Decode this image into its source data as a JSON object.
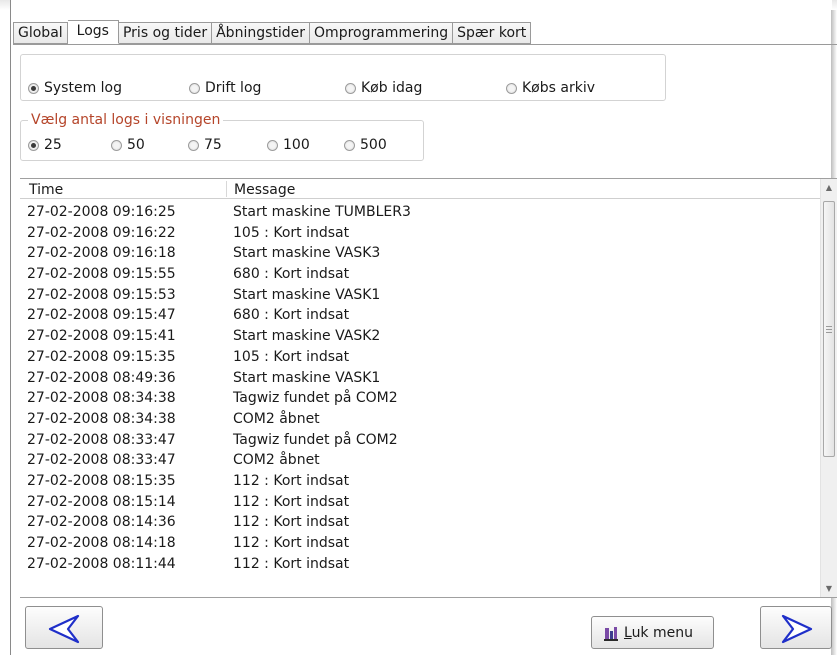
{
  "tabs": [
    {
      "label": "Global",
      "active": false
    },
    {
      "label": "Logs",
      "active": true
    },
    {
      "label": "Pris og tider",
      "active": false
    },
    {
      "label": "Åbningstider",
      "active": false
    },
    {
      "label": "Omprogrammering",
      "active": false
    },
    {
      "label": "Spær kort",
      "active": false
    }
  ],
  "log_type": {
    "options": [
      {
        "label": "System log",
        "checked": true
      },
      {
        "label": "Drift log",
        "checked": false
      },
      {
        "label": "Køb idag",
        "checked": false
      },
      {
        "label": "Købs arkiv",
        "checked": false
      }
    ]
  },
  "log_count": {
    "legend": "Vælg antal logs i visningen",
    "options": [
      {
        "label": "25",
        "checked": true
      },
      {
        "label": "50",
        "checked": false
      },
      {
        "label": "75",
        "checked": false
      },
      {
        "label": "100",
        "checked": false
      },
      {
        "label": "500",
        "checked": false
      }
    ]
  },
  "log_list": {
    "columns": {
      "time": "Time",
      "message": "Message"
    },
    "rows": [
      {
        "time": "27-02-2008 09:16:25",
        "message": "Start maskine TUMBLER3"
      },
      {
        "time": "27-02-2008 09:16:22",
        "message": "105 : Kort indsat"
      },
      {
        "time": "27-02-2008 09:16:18",
        "message": "Start maskine VASK3"
      },
      {
        "time": "27-02-2008 09:15:55",
        "message": "680 : Kort indsat"
      },
      {
        "time": "27-02-2008 09:15:53",
        "message": "Start maskine VASK1"
      },
      {
        "time": "27-02-2008 09:15:47",
        "message": "680 : Kort indsat"
      },
      {
        "time": "27-02-2008 09:15:41",
        "message": "Start maskine VASK2"
      },
      {
        "time": "27-02-2008 09:15:35",
        "message": "105 : Kort indsat"
      },
      {
        "time": "27-02-2008 08:49:36",
        "message": "Start maskine VASK1"
      },
      {
        "time": "27-02-2008 08:34:38",
        "message": "Tagwiz fundet på COM2"
      },
      {
        "time": "27-02-2008 08:34:38",
        "message": "COM2 åbnet"
      },
      {
        "time": "27-02-2008 08:33:47",
        "message": "Tagwiz fundet på COM2"
      },
      {
        "time": "27-02-2008 08:33:47",
        "message": "COM2 åbnet"
      },
      {
        "time": "27-02-2008 08:15:35",
        "message": "112 : Kort indsat"
      },
      {
        "time": "27-02-2008 08:15:14",
        "message": "112 : Kort indsat"
      },
      {
        "time": "27-02-2008 08:14:36",
        "message": "112 : Kort indsat"
      },
      {
        "time": "27-02-2008 08:14:18",
        "message": "112 : Kort indsat"
      },
      {
        "time": "27-02-2008 08:11:44",
        "message": "112 : Kort indsat"
      }
    ]
  },
  "buttons": {
    "back_icon": "arrow-left-icon",
    "forward_icon": "arrow-right-icon",
    "close_menu": {
      "mnemonic": "L",
      "rest": "uk menu",
      "icon": "menu-icon"
    }
  },
  "colors": {
    "accent_arrow": "#1f2fc9",
    "legend_text": "#b5452a",
    "menu_icon_purple": "#7a4aa6"
  }
}
